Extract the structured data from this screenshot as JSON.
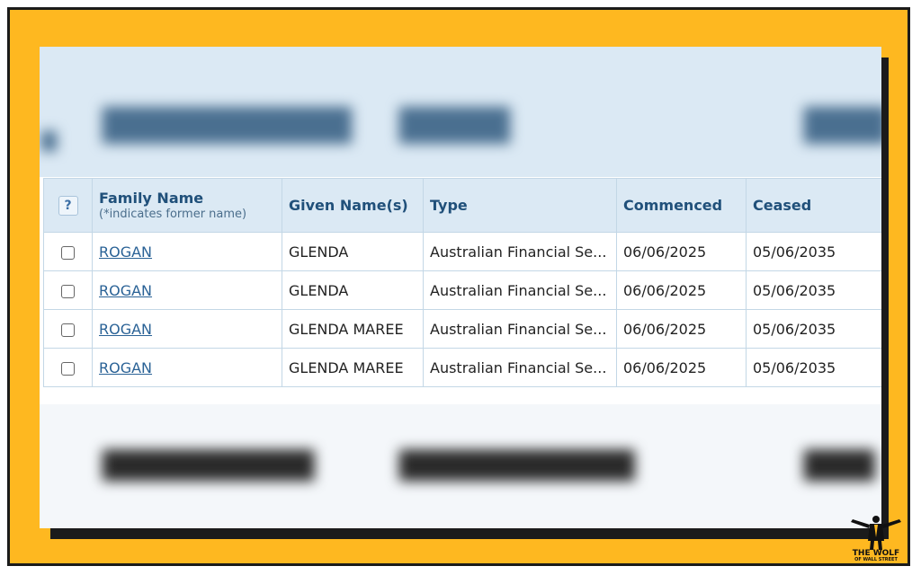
{
  "table": {
    "headers": {
      "help": "?",
      "family_name": "Family Name",
      "family_name_sub": "(*indicates former name)",
      "given_names": "Given Name(s)",
      "type": "Type",
      "commenced": "Commenced",
      "ceased": "Ceased"
    },
    "rows": [
      {
        "family_name": "ROGAN",
        "given_names": "GLENDA",
        "type": "Australian Financial Se...",
        "commenced": "06/06/2025",
        "ceased": "05/06/2035"
      },
      {
        "family_name": "ROGAN",
        "given_names": "GLENDA",
        "type": "Australian Financial Se...",
        "commenced": "06/06/2025",
        "ceased": "05/06/2035"
      },
      {
        "family_name": "ROGAN",
        "given_names": "GLENDA MAREE",
        "type": "Australian Financial Se...",
        "commenced": "06/06/2025",
        "ceased": "05/06/2035"
      },
      {
        "family_name": "ROGAN",
        "given_names": "GLENDA MAREE",
        "type": "Australian Financial Se...",
        "commenced": "06/06/2025",
        "ceased": "05/06/2035"
      }
    ]
  },
  "logo": {
    "line1": "THE WOLF",
    "line2": "OF WALL STREET"
  },
  "colors": {
    "frame": "#FEB820",
    "header_bg": "#dbe9f4",
    "link": "#2a6296"
  }
}
